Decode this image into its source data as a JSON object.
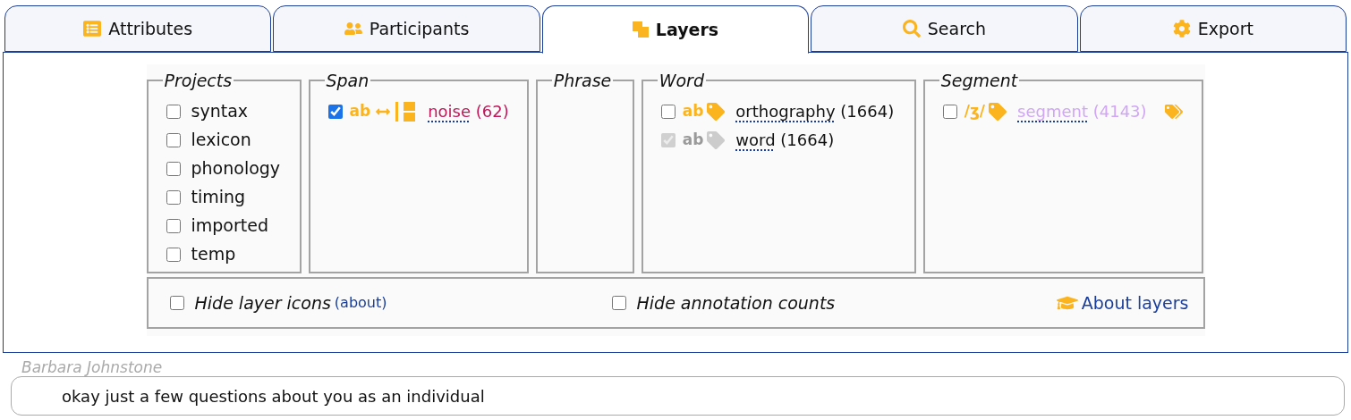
{
  "tabs": [
    {
      "label": "Attributes",
      "kind": "list",
      "selected": false
    },
    {
      "label": "Participants",
      "kind": "people",
      "selected": false
    },
    {
      "label": "Layers",
      "kind": "layers",
      "selected": true
    },
    {
      "label": "Search",
      "kind": "search",
      "selected": false
    },
    {
      "label": "Export",
      "kind": "gear",
      "selected": false
    }
  ],
  "groups": [
    {
      "title": "Projects",
      "kind": "projects",
      "items": [
        {
          "label": "syntax",
          "checked": false
        },
        {
          "label": "lexicon",
          "checked": false
        },
        {
          "label": "phonology",
          "checked": false
        },
        {
          "label": "timing",
          "checked": false
        },
        {
          "label": "imported",
          "checked": false
        },
        {
          "label": "temp",
          "checked": false
        }
      ]
    },
    {
      "title": "Span",
      "kind": "layers",
      "items": [
        {
          "checked": true,
          "disabled": false,
          "type_label": "ab",
          "kind": "span",
          "name": "noise",
          "count": "(62)",
          "color": "#c2185b"
        }
      ]
    },
    {
      "title": "Phrase",
      "kind": "layers"
    },
    {
      "title": "Word",
      "kind": "layers",
      "items": [
        {
          "checked": false,
          "disabled": false,
          "type_label": "ab",
          "kind": "tag",
          "name": "orthography",
          "count": "(1664)",
          "color": "#111111"
        },
        {
          "checked": true,
          "disabled": true,
          "type_label": "ab",
          "kind": "tag",
          "name": "word",
          "count": "(1664)",
          "color": "#111111"
        }
      ]
    },
    {
      "title": "Segment",
      "kind": "layers",
      "items": [
        {
          "checked": false,
          "disabled": false,
          "type_label": "/ʒ/",
          "kind": "tag-multi",
          "name": "segment",
          "count": "(4143)",
          "color": "#d0a6f5"
        }
      ]
    }
  ],
  "options": [
    {
      "label": "Hide layer icons",
      "link": "(about)",
      "checked": false
    },
    {
      "label": "Hide annotation counts",
      "checked": false
    }
  ],
  "about_link": "About layers",
  "transcript": {
    "speaker": "Barbara Johnstone",
    "utterance": "okay just a few questions about you as an individual"
  }
}
